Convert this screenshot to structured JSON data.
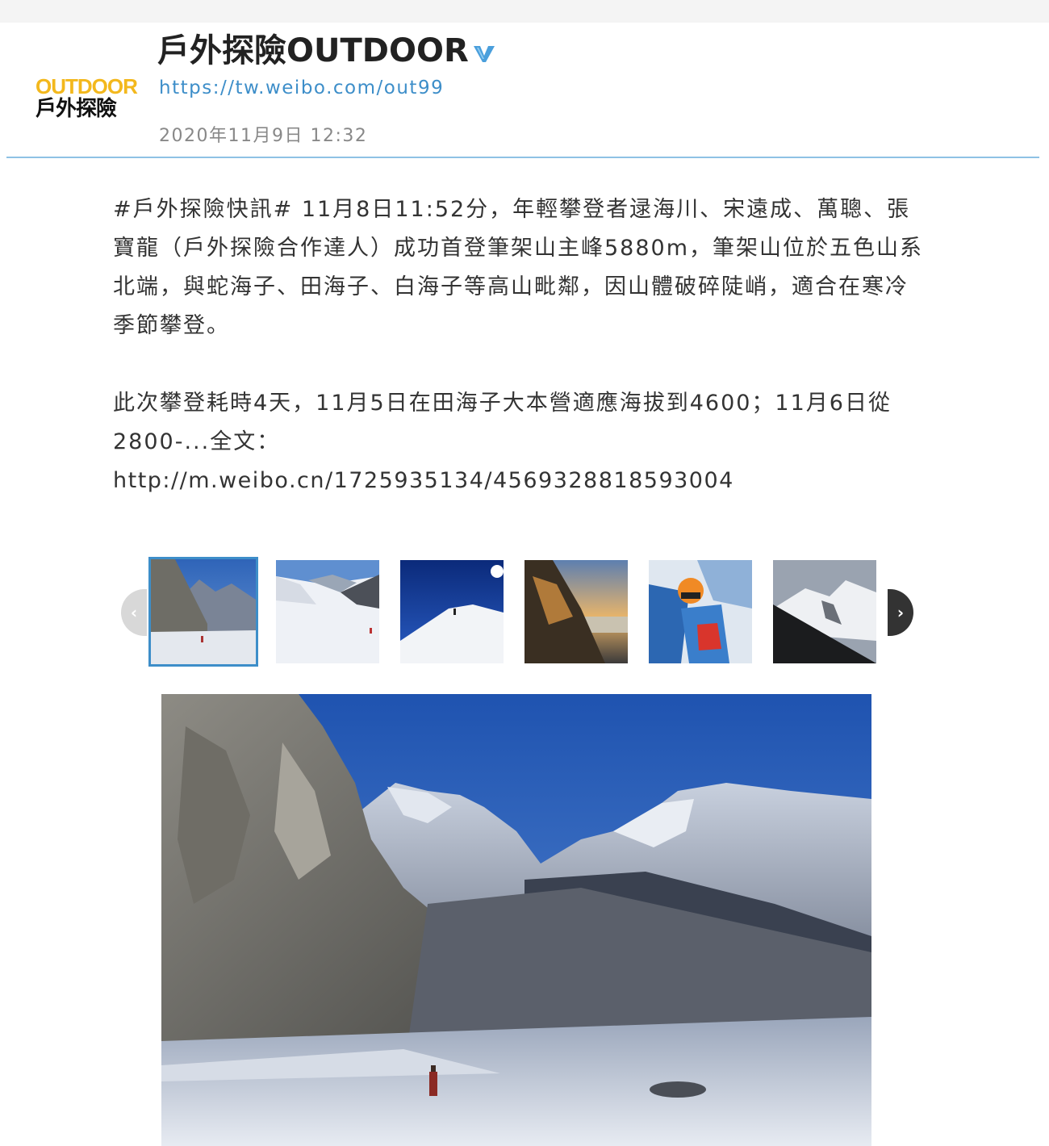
{
  "header": {
    "name": "戶外探險OUTDOOR",
    "profile_url": "https://tw.weibo.com/out99",
    "date": "2020年11月9日 12:32",
    "logo": {
      "text_en": "OUTDOOR",
      "text_zh": "戶外探險"
    },
    "verified_icon": "verified-v-icon"
  },
  "post": {
    "paragraph1": "#戶外探險快訊# 11月8日11:52分，年輕攀登者逯海川、宋遠成、萬聰、張寶龍（戶外探險合作達人）成功首登筆架山主峰5880m，筆架山位於五色山系北端，與蛇海子、田海子、白海子等高山毗鄰，因山體破碎陡峭，適合在寒冷季節攀登。",
    "paragraph2": "此次攀登耗時4天，11月5日在田海子大本營適應海拔到4600；11月6日從2800-...全文：",
    "link": "http://m.weibo.cn/1725935134/4569328818593004"
  },
  "gallery": {
    "prev_icon": "‹",
    "next_icon": "›",
    "thumbnails": [
      {
        "subject": "mountain-valley-with-climber"
      },
      {
        "subject": "snow-slope-with-climbers"
      },
      {
        "subject": "snow-ridge-under-blue-sky"
      },
      {
        "subject": "sunset-over-cloud-sea"
      },
      {
        "subject": "climber-selfie-orange-helmet"
      },
      {
        "subject": "snowy-peak-silhouette"
      }
    ],
    "selected_index": 0
  },
  "colors": {
    "accent": "#3d8ec9",
    "divider": "#8ec2e4",
    "logo_yellow": "#f3b81d"
  }
}
